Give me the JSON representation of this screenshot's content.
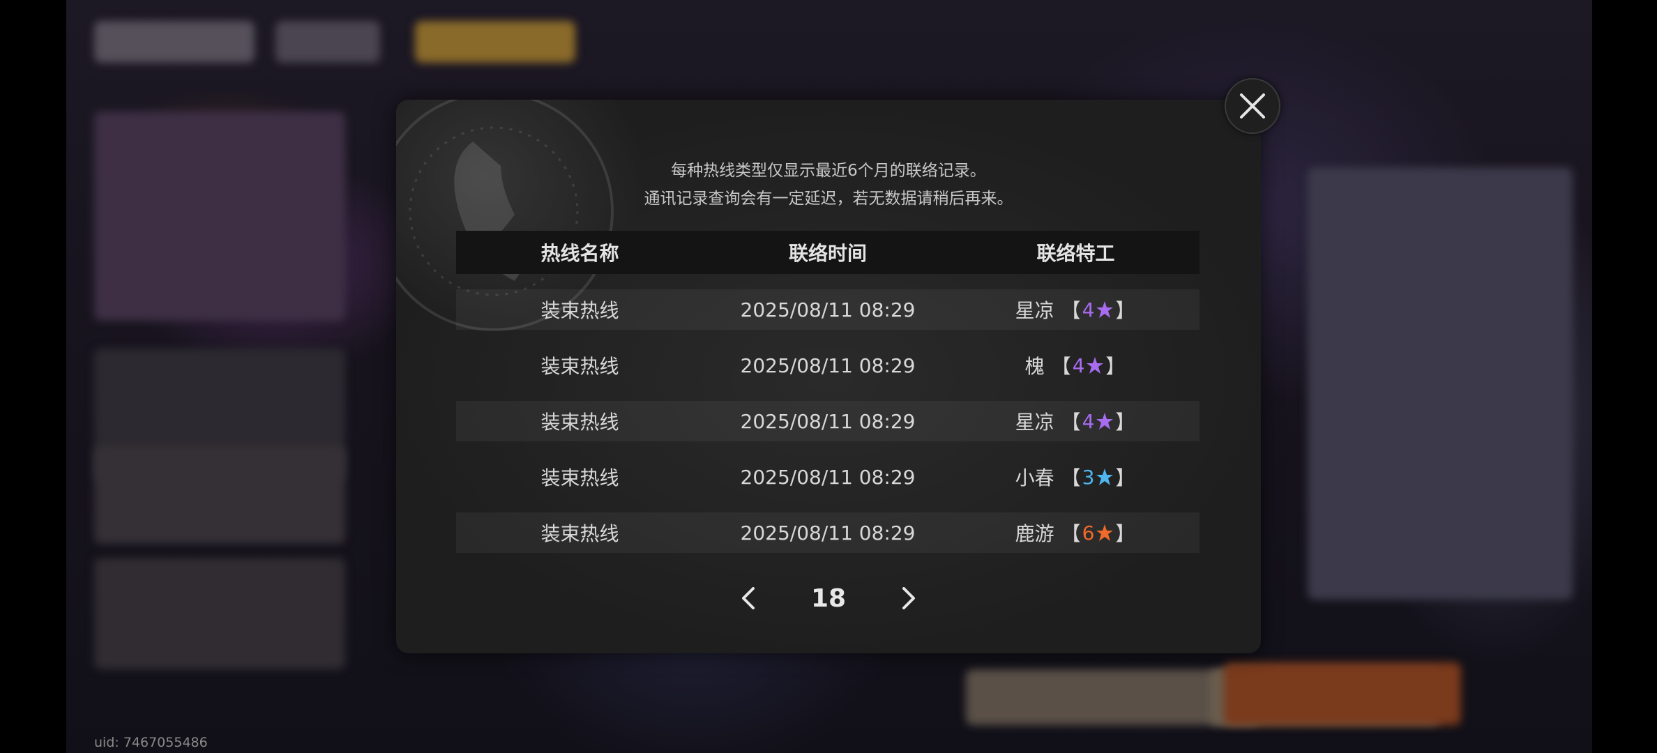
{
  "footer": {
    "uid": "uid: 7467055486"
  },
  "dialog": {
    "notice_line1": "每种热线类型仅显示最近6个月的联络记录。",
    "notice_line2": "通讯记录查询会有一定延迟，若无数据请稍后再来。",
    "columns": [
      "热线名称",
      "联络时间",
      "联络特工"
    ],
    "rows": [
      {
        "hotline": "装束热线",
        "time": "2025/08/11 08:29",
        "agent": "星凉",
        "rank": "4",
        "rank_color": "#a86cf0"
      },
      {
        "hotline": "装束热线",
        "time": "2025/08/11 08:29",
        "agent": "槐",
        "rank": "4",
        "rank_color": "#a86cf0"
      },
      {
        "hotline": "装束热线",
        "time": "2025/08/11 08:29",
        "agent": "星凉",
        "rank": "4",
        "rank_color": "#a86cf0"
      },
      {
        "hotline": "装束热线",
        "time": "2025/08/11 08:29",
        "agent": "小春",
        "rank": "3",
        "rank_color": "#4fb6f0"
      },
      {
        "hotline": "装束热线",
        "time": "2025/08/11 08:29",
        "agent": "鹿游",
        "rank": "6",
        "rank_color": "#f06a2a"
      }
    ],
    "bracket_open": "【",
    "bracket_close": "】",
    "page": "18",
    "icons": {
      "prev": "chevron-left-icon",
      "next": "chevron-right-icon",
      "close": "close-icon",
      "star": "star-icon",
      "emblem": "phone-icon"
    }
  }
}
